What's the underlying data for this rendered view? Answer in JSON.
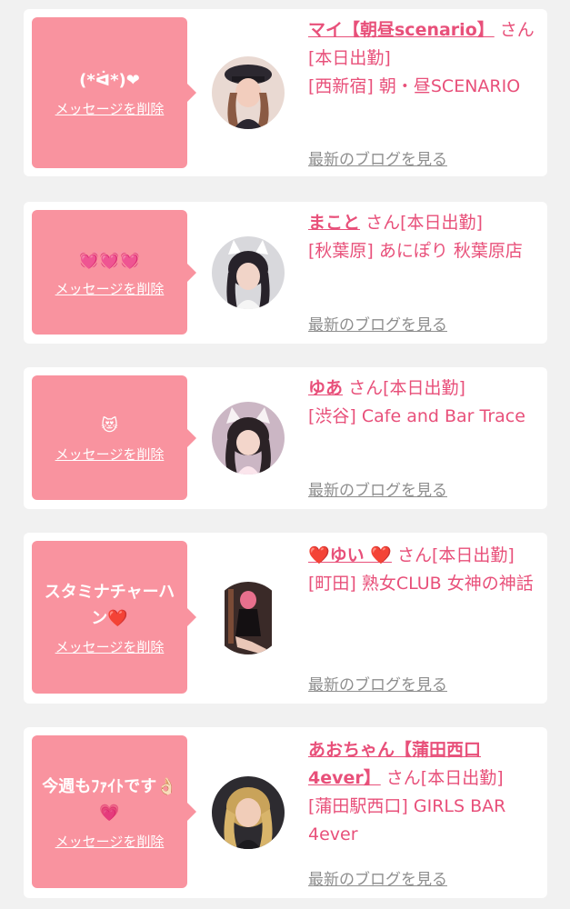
{
  "common": {
    "delete_label": "メッセージを削除",
    "blog_label": "最新のブログを見る"
  },
  "cards": [
    {
      "message": "(*ᐛ*)❤",
      "name": "マイ【朝昼scenario】",
      "status": "さん[本日出勤]",
      "shop": "[西新宿] 朝・昼SCENARIO"
    },
    {
      "message": "💓💓💓",
      "name": "まこと",
      "status": "さん[本日出勤]",
      "shop": "[秋葉原] あにぽり 秋葉原店"
    },
    {
      "message": "😻",
      "name": "ゆあ",
      "status": "さん[本日出勤]",
      "shop": "[渋谷] Cafe and Bar Trace"
    },
    {
      "message": "スタミナチャーハン❤️",
      "name": "❤️ゆい ❤️",
      "status": "さん[本日出勤]",
      "shop": "[町田] 熟女CLUB 女神の神話"
    },
    {
      "message": "今週もﾌｧｲﾄです👌🏻💗",
      "name": "あおちゃん【蒲田西口4ever】",
      "status": "さん[本日出勤]",
      "shop": "[蒲田駅西口] GIRLS BAR 4ever"
    }
  ],
  "colors": {
    "accent": "#e8507a",
    "bubble": "#f9939f",
    "background": "#f1f1f1",
    "link_gray": "#8e8e8e"
  }
}
